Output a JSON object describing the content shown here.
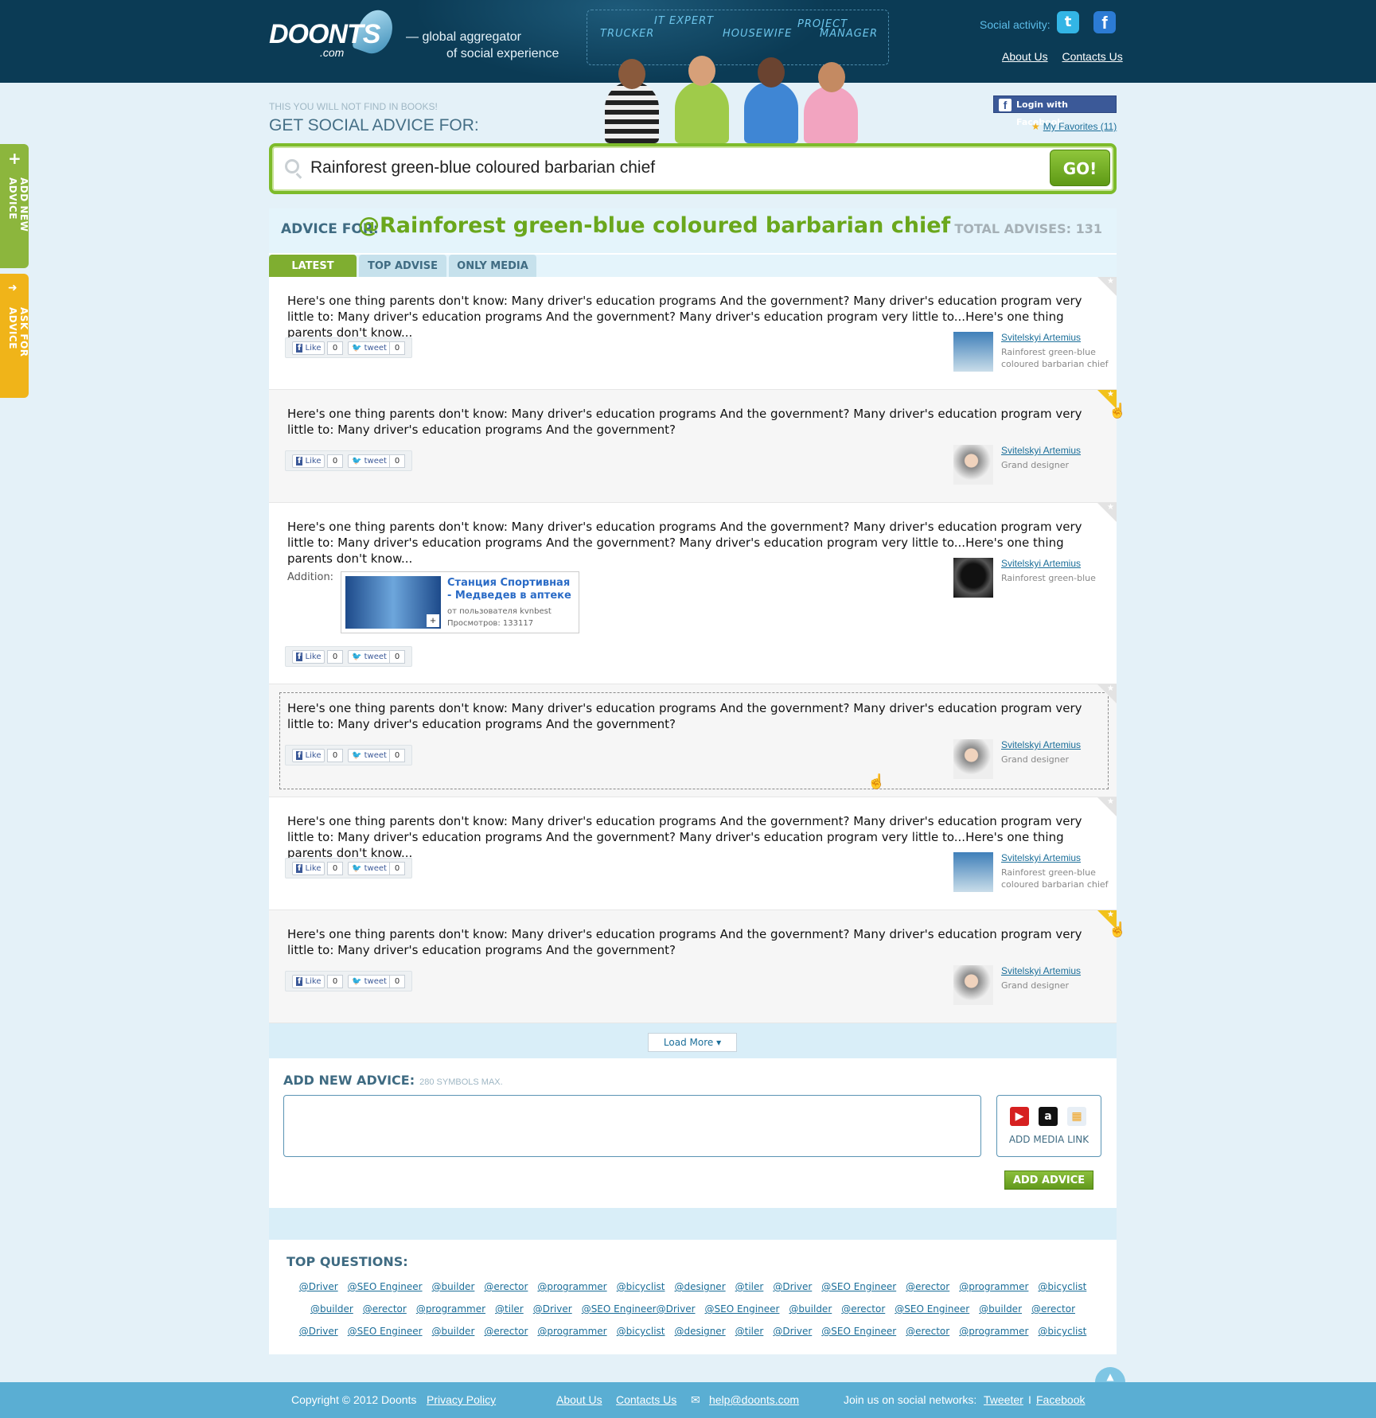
{
  "header": {
    "logo": "DOONTS",
    "logo_suffix": ".com",
    "tagline_line1": "— global aggregator",
    "tagline_line2": "of social experience",
    "roles": [
      "TRUCKER",
      "IT EXPERT",
      "HOUSEWIFE",
      "PROJECT",
      "MANAGER"
    ],
    "social_activity_label": "Social activity:",
    "links": [
      "About Us",
      "Contacts Us"
    ]
  },
  "sidebar_tabs": {
    "add_new": "ADD NEW ADVICE",
    "ask": "ASK FOR ADVICE"
  },
  "search_section": {
    "kicker": "THIS YOU WILL NOT FIND IN BOOKS!",
    "title": "GET SOCIAL ADVICE FOR:",
    "login_facebook": "Login with Facebook",
    "favorites": "My Favorites (11)",
    "query": "Rainforest green-blue coloured barbarian chief",
    "go_label": "GO!"
  },
  "advice": {
    "label": "ADVICE FOR:",
    "query": "@Rainforest green-blue coloured barbarian chief",
    "total": "TOTAL ADVISES: 131",
    "tabs": [
      "LATEST",
      "TOP ADVISE",
      "ONLY MEDIA"
    ],
    "like_label": "Like",
    "tweet_label": "tweet",
    "like_count": "0",
    "tweet_count": "0",
    "addition_label": "Addition:",
    "items": [
      {
        "text": "Here's one thing parents don't know: Many driver's education programs  And the government? Many driver's education program very little to: Many driver's education programs And the government? Many driver's education program very little to...Here's one thing parents don't know...",
        "author": "Svitelskyi Artemius",
        "role": "Rainforest green-blue coloured barbarian chief",
        "starred": false
      },
      {
        "text": "Here's one thing parents don't know: Many driver's education programs  And the government? Many driver's education program very little to: Many driver's education programs And the government?",
        "author": "Svitelskyi Artemius",
        "role": "Grand designer",
        "starred": true
      },
      {
        "text": "Here's one thing parents don't know: Many driver's education programs  And the government? Many driver's education program very little to: Many driver's education programs And the government? Many driver's education program very little to...Here's one thing parents don't know...",
        "author": "Svitelskyi Artemius",
        "role": "Rainforest green-blue",
        "starred": false
      },
      {
        "text": "Here's one thing parents don't know: Many driver's education programs  And the government? Many driver's education program very little to: Many driver's education programs And the government?",
        "author": "Svitelskyi Artemius",
        "role": "Grand designer",
        "starred": false
      },
      {
        "text": "Here's one thing parents don't know: Many driver's education programs  And the government? Many driver's education program very little to: Many driver's education programs And the government? Many driver's education program very little to...Here's one thing parents don't know...",
        "author": "Svitelskyi Artemius",
        "role": "Rainforest green-blue coloured barbarian chief",
        "starred": false
      },
      {
        "text": "Here's one thing parents don't know: Many driver's education programs  And the government? Many driver's education program very little to: Many driver's education programs And the government?",
        "author": "Svitelskyi Artemius",
        "role": "Grand designer",
        "starred": true
      }
    ],
    "media": {
      "title": "Станция Спортивная - Медведев в аптеке",
      "from": "от пользователя kvnbest",
      "views": "Просмотров: 133117"
    },
    "load_more": "Load More ▾"
  },
  "add_new": {
    "title": "ADD NEW ADVICE:",
    "hint": "280 SYMBOLS MAX.",
    "media_link": "ADD MEDIA LINK",
    "submit": "ADD ADVICE"
  },
  "top_questions": {
    "title": "TOP QUESTIONS:",
    "rows": [
      [
        "@Driver",
        "@SEO Engineer",
        "@builder",
        "@erector",
        "@programmer",
        "@bicyclist",
        "@designer",
        "@tiler",
        "@Driver",
        "@SEO Engineer",
        "@erector",
        "@programmer",
        "@bicyclist"
      ],
      [
        "@builder",
        "@erector",
        "@programmer",
        "@tiler",
        "@Driver",
        "@SEO Engineer@Driver",
        "@SEO Engineer",
        "@builder",
        "@erector",
        "@SEO Engineer",
        "@builder",
        "@erector"
      ],
      [
        "@Driver",
        "@SEO Engineer",
        "@builder",
        "@erector",
        "@programmer",
        "@bicyclist",
        "@designer",
        "@tiler",
        "@Driver",
        "@SEO Engineer",
        "@erector",
        "@programmer",
        "@bicyclist"
      ]
    ]
  },
  "footer": {
    "copyright": "Copyright © 2012 Doonts",
    "privacy": "Privacy Policy",
    "about": "About Us",
    "contacts": "Contacts Us",
    "email": "help@doonts.com",
    "join": "Join us on social networks:",
    "tweeter": "Tweeter",
    "separator": "I",
    "facebook": "Facebook",
    "up": "Up"
  }
}
